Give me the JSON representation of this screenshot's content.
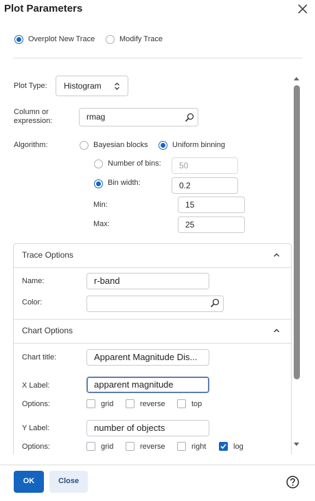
{
  "dialog": {
    "title": "Plot Parameters"
  },
  "mode": {
    "overplot_label": "Overplot New Trace",
    "modify_label": "Modify Trace",
    "selected": "overplot"
  },
  "plot_type": {
    "label": "Plot Type:",
    "value": "Histogram"
  },
  "column": {
    "label_line1": "Column or",
    "label_line2": "expression:",
    "value": "rmag"
  },
  "algorithm": {
    "label": "Algorithm:",
    "bayesian_label": "Bayesian blocks",
    "uniform_label": "Uniform binning",
    "selected": "uniform",
    "num_bins_label": "Number of bins:",
    "num_bins_value": "50",
    "bin_width_label": "Bin width:",
    "bin_width_value": "0.2",
    "binning_selected": "bin_width",
    "min_label": "Min:",
    "min_value": "15",
    "max_label": "Max:",
    "max_value": "25"
  },
  "trace_options": {
    "header": "Trace Options",
    "name_label": "Name:",
    "name_value": "r-band",
    "color_label": "Color:",
    "color_value": ""
  },
  "chart_options": {
    "header": "Chart Options",
    "title_label": "Chart title:",
    "title_value": "Apparent Magnitude Dis...",
    "xlabel_label": "X Label:",
    "xlabel_value": "apparent magnitude",
    "x_options_label": "Options:",
    "x_options": [
      {
        "label": "grid",
        "checked": false
      },
      {
        "label": "reverse",
        "checked": false
      },
      {
        "label": "top",
        "checked": false
      }
    ],
    "ylabel_label": "Y Label:",
    "ylabel_value": "number of objects",
    "y_options_label": "Options:",
    "y_options": [
      {
        "label": "grid",
        "checked": false
      },
      {
        "label": "reverse",
        "checked": false
      },
      {
        "label": "right",
        "checked": false
      },
      {
        "label": "log",
        "checked": true
      }
    ]
  },
  "buttons": {
    "ok_label": "OK",
    "close_label": "Close"
  },
  "colors": {
    "accent": "#1565c0",
    "border": "#c8ccd0",
    "close_button_bg": "#e7eef8"
  },
  "icons": {
    "close": "close-icon",
    "help": "help-icon",
    "search": "search-icon",
    "select_arrows": "updown-chevron-icon",
    "collapse": "chevron-up-icon"
  }
}
